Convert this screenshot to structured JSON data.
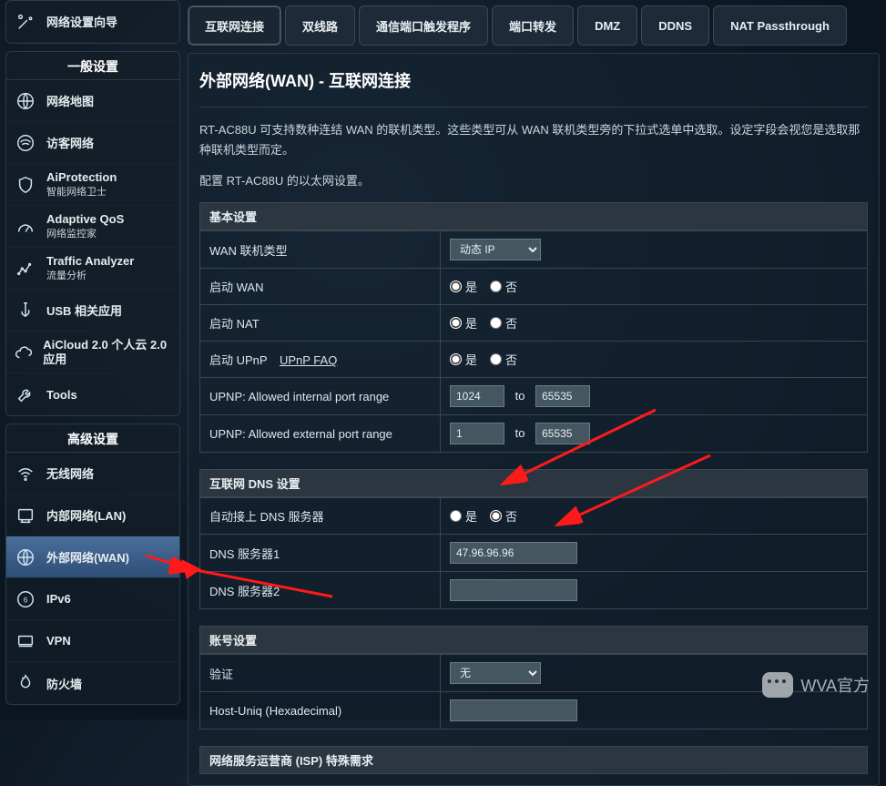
{
  "sidebar": {
    "wizard": {
      "label": "网络设置向导"
    },
    "sections": [
      {
        "title": "一般设置",
        "items": [
          {
            "id": "net-map",
            "label": "网络地图"
          },
          {
            "id": "guest-net",
            "label": "访客网络"
          },
          {
            "id": "aiprotection",
            "label": "AiProtection",
            "sub": "智能网络卫士"
          },
          {
            "id": "adaptive-qos",
            "label": "Adaptive QoS",
            "sub": "网络监控家"
          },
          {
            "id": "traffic",
            "label": "Traffic Analyzer",
            "sub": "流量分析"
          },
          {
            "id": "usb",
            "label": "USB 相关应用"
          },
          {
            "id": "aicloud",
            "label": "AiCloud 2.0 个人云 2.0 应用"
          },
          {
            "id": "tools",
            "label": "Tools"
          }
        ]
      },
      {
        "title": "高级设置",
        "items": [
          {
            "id": "wireless",
            "label": "无线网络"
          },
          {
            "id": "lan",
            "label": "内部网络(LAN)"
          },
          {
            "id": "wan",
            "label": "外部网络(WAN)",
            "selected": true
          },
          {
            "id": "ipv6",
            "label": "IPv6"
          },
          {
            "id": "vpn",
            "label": "VPN"
          },
          {
            "id": "firewall",
            "label": "防火墙"
          }
        ]
      }
    ]
  },
  "tabs": [
    {
      "id": "internet",
      "label": "互联网连接",
      "on": true
    },
    {
      "id": "dualwan",
      "label": "双线路"
    },
    {
      "id": "porttrigger",
      "label": "通信端口触发程序"
    },
    {
      "id": "portforward",
      "label": "端口转发"
    },
    {
      "id": "dmz",
      "label": "DMZ"
    },
    {
      "id": "ddns",
      "label": "DDNS"
    },
    {
      "id": "natpass",
      "label": "NAT Passthrough"
    }
  ],
  "page": {
    "title": "外部网络(WAN) - 互联网连接",
    "desc1": "RT-AC88U 可支持数种连结 WAN 的联机类型。这些类型可从 WAN 联机类型旁的下拉式选单中选取。设定字段会视您是选取那种联机类型而定。",
    "desc2": "配置 RT-AC88U 的以太网设置。"
  },
  "basic": {
    "section": "基本设置",
    "wan_type_label": "WAN 联机类型",
    "wan_type_value": "动态 IP",
    "enable_wan_label": "启动 WAN",
    "enable_nat_label": "启动 NAT",
    "enable_upnp_label": "启动 UPnP",
    "upnp_faq": "UPnP   FAQ",
    "yes": "是",
    "no": "否",
    "upnp_int_label": "UPNP: Allowed internal port range",
    "upnp_int_from": "1024",
    "to": "to",
    "upnp_int_to": "65535",
    "upnp_ext_label": "UPNP: Allowed external port range",
    "upnp_ext_from": "1",
    "upnp_ext_to": "65535"
  },
  "dns": {
    "section": "互联网 DNS 设置",
    "auto_label": "自动接上 DNS 服务器",
    "yes": "是",
    "no": "否",
    "dns1_label": "DNS 服务器1",
    "dns1_value": "47.96.96.96",
    "dns2_label": "DNS 服务器2",
    "dns2_value": ""
  },
  "acct": {
    "section": "账号设置",
    "auth_label": "验证",
    "auth_value": "无",
    "hostuniq_label": "Host-Uniq (Hexadecimal)"
  },
  "isp": {
    "section": "网络服务运营商 (ISP) 特殊需求"
  },
  "watermark": "WVA官方"
}
